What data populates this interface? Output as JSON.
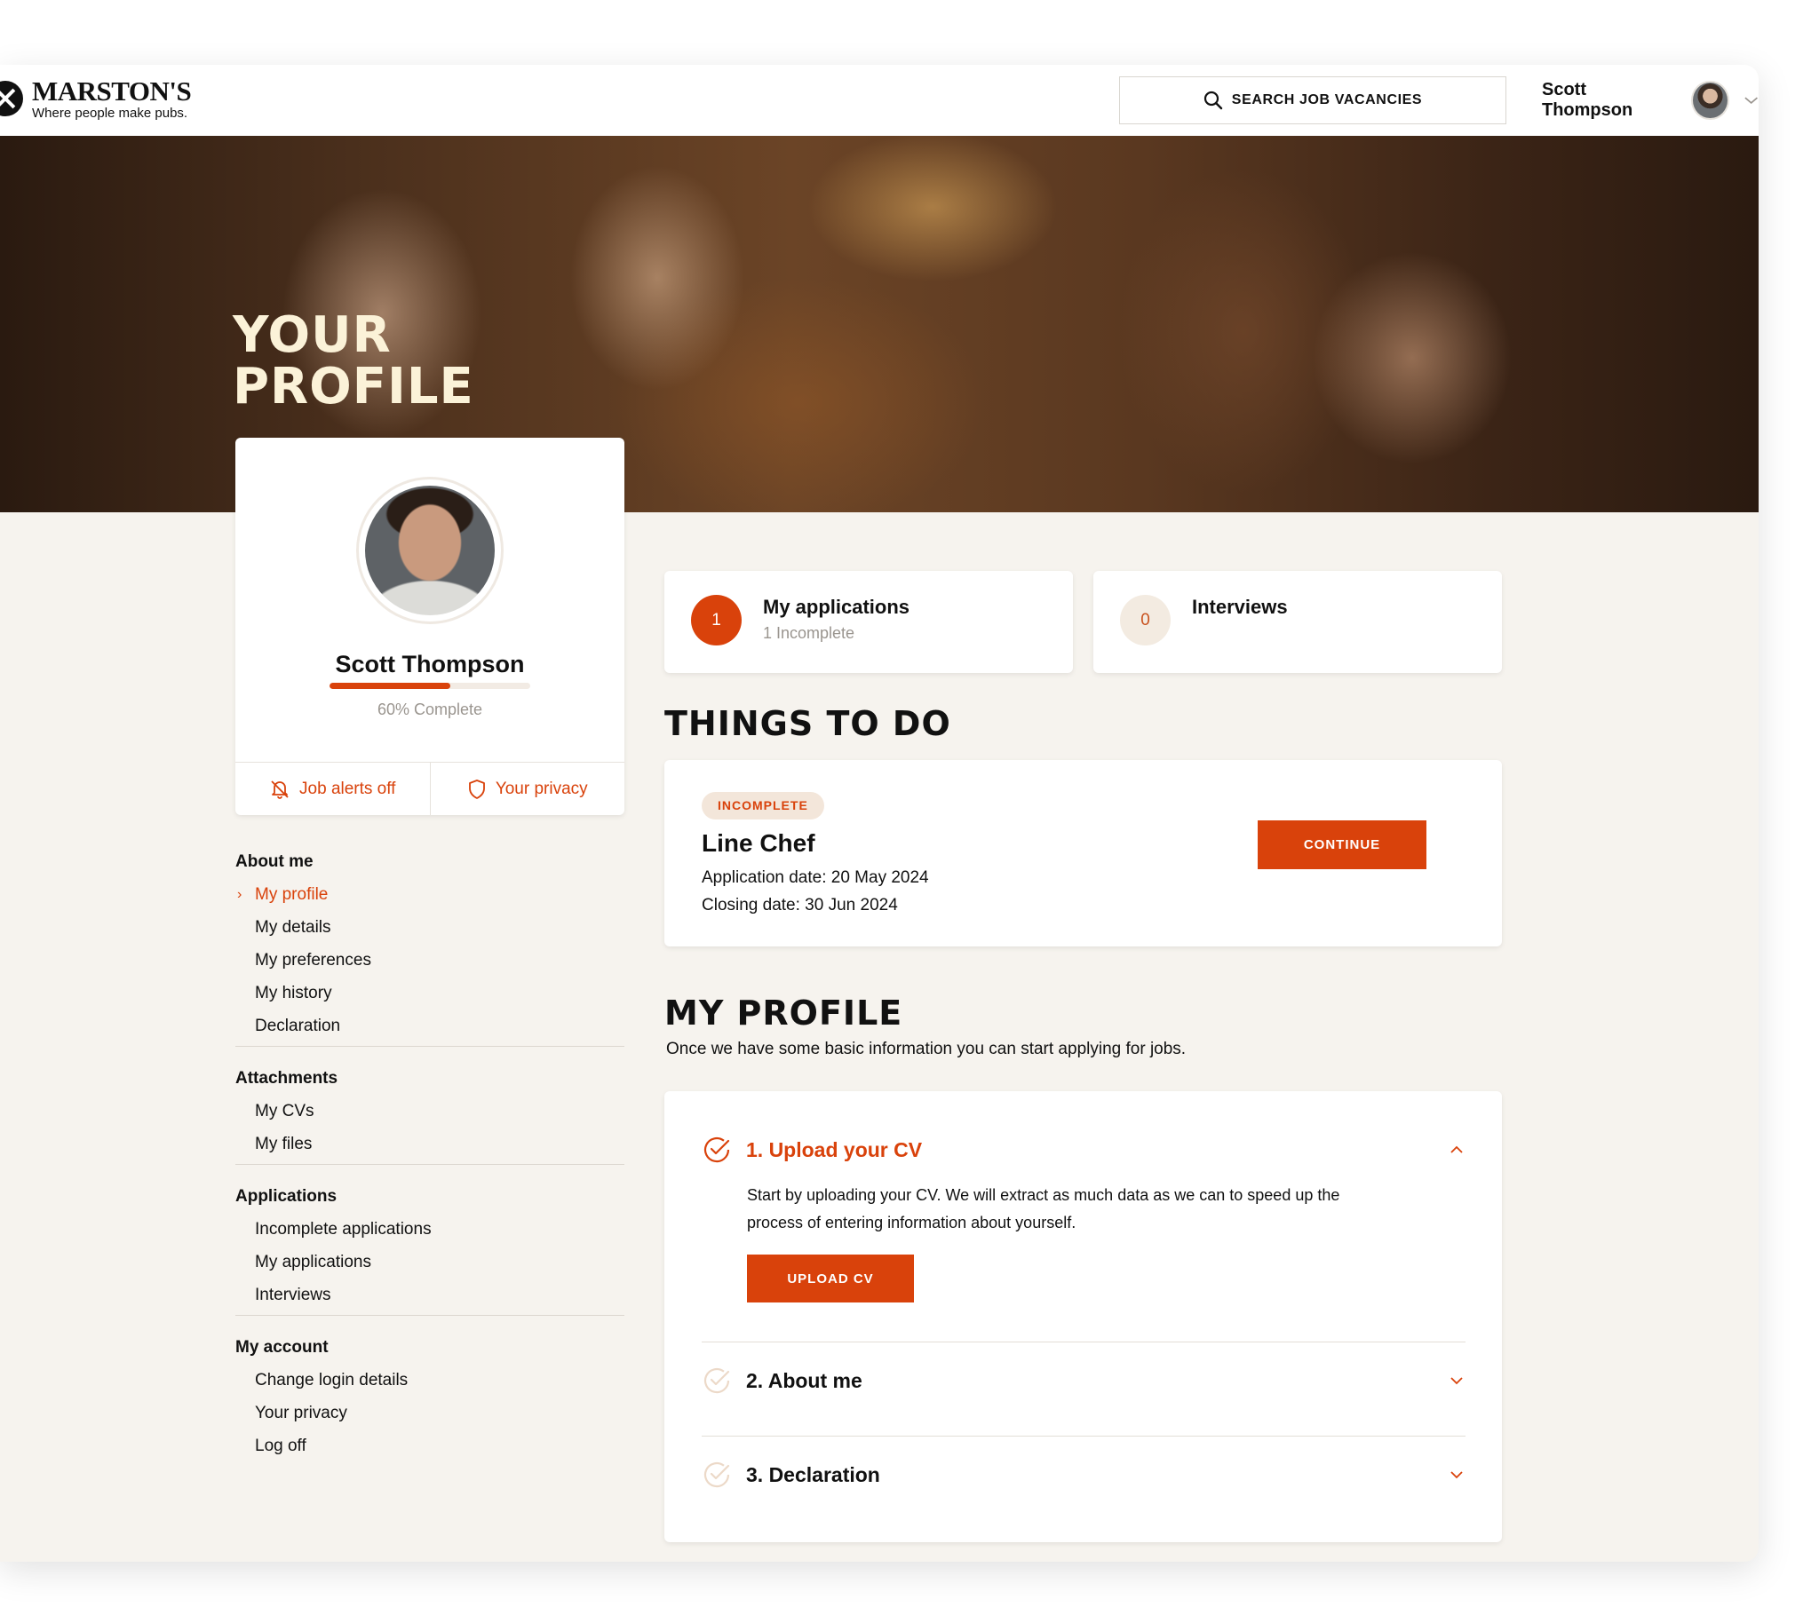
{
  "brand": {
    "name": "MARSTON'S",
    "tagline": "Where people make pubs."
  },
  "header": {
    "search_label": "SEARCH JOB VACANCIES",
    "user_name": "Scott Thompson"
  },
  "hero": {
    "title_line1": "YOUR",
    "title_line2": "PROFILE"
  },
  "profile_card": {
    "name": "Scott Thompson",
    "progress_fraction": 0.6,
    "complete_label": "60% Complete",
    "job_alerts_label": "Job alerts off",
    "privacy_label": "Your privacy"
  },
  "sidenav": {
    "groups": [
      {
        "heading": "About me",
        "items": [
          "My profile",
          "My details",
          "My preferences",
          "My history",
          "Declaration"
        ]
      },
      {
        "heading": "Attachments",
        "items": [
          "My CVs",
          "My files"
        ]
      },
      {
        "heading": "Applications",
        "items": [
          "Incomplete applications",
          "My applications",
          "Interviews"
        ]
      },
      {
        "heading": "My account",
        "items": [
          "Change login details",
          "Your privacy",
          "Log off"
        ]
      }
    ],
    "active_item": "My profile"
  },
  "stats": {
    "applications": {
      "count": "1",
      "title": "My applications",
      "sub": "1 Incomplete"
    },
    "interviews": {
      "count": "0",
      "title": "Interviews"
    }
  },
  "things_to_do": {
    "title": "THINGS TO DO",
    "status": "INCOMPLETE",
    "job": "Line Chef",
    "application_date": "Application date: 20 May 2024",
    "closing_date": "Closing date: 30 Jun 2024",
    "continue_label": "CONTINUE"
  },
  "my_profile": {
    "title": "MY PROFILE",
    "intro": "Once we have some basic information you can start applying for jobs.",
    "steps": [
      {
        "label": "1. Upload your CV",
        "description": "Start by uploading your CV. We will extract as much data as we can to speed up the process of entering information about yourself.",
        "button": "UPLOAD CV"
      },
      {
        "label": "2. About me"
      },
      {
        "label": "3. Declaration"
      }
    ]
  },
  "colors": {
    "accent": "#d9420b",
    "background": "#f6f3ee",
    "hero_title": "#fbf2d8"
  }
}
